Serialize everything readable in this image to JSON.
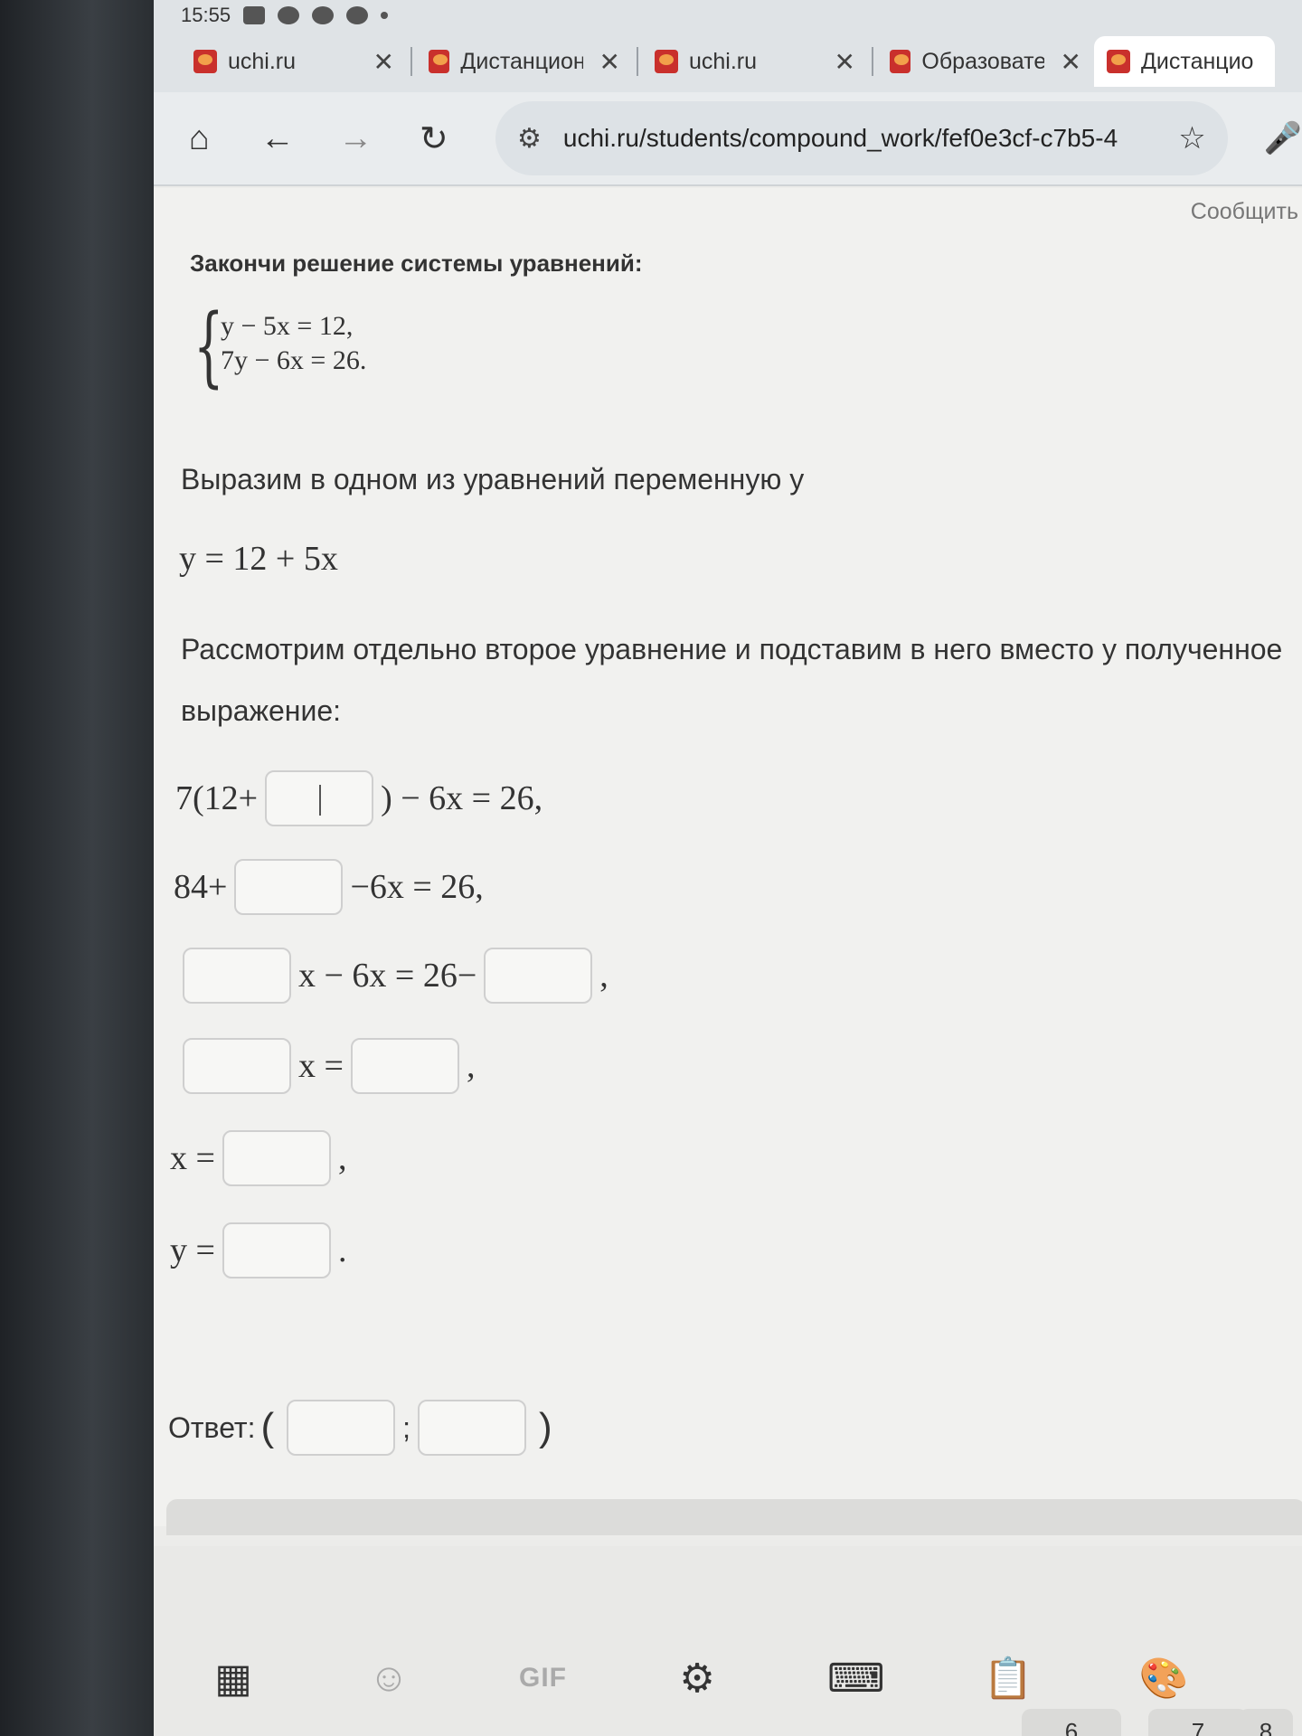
{
  "status": {
    "time": "15:55"
  },
  "tabs": [
    {
      "title": "uchi.ru"
    },
    {
      "title": "Дистанцион"
    },
    {
      "title": "uchi.ru"
    },
    {
      "title": "Образовате"
    },
    {
      "title": "Дистанцио"
    }
  ],
  "toolbar": {
    "url": "uchi.ru/students/compound_work/fef0e3cf-c7b5-4"
  },
  "page": {
    "report": "Сообщить",
    "task_title": "Закончи решение системы уравнений:",
    "system": [
      "y − 5x = 12,",
      "7y − 6x = 26."
    ],
    "express_text": "Выразим в одном из уравнений переменную y",
    "express_eq": "y = 12 + 5x",
    "substitute_text_1": "Рассмотрим отдельно второе уравнение и подставим в него вместо y полученное",
    "substitute_text_2": "выражение:",
    "line1_prefix": "7(12+",
    "line1_suffix": ") − 6x = 26,",
    "line2_prefix": "84+",
    "line2_suffix": "−6x = 26,",
    "line3_mid": "x − 6x = 26−",
    "line3_end": ",",
    "line4_mid": "x =",
    "line4_end": ",",
    "line5_prefix": "x =",
    "line5_end": ",",
    "line6_prefix": "y =",
    "line6_end": ".",
    "answer_label": "Ответ:",
    "answer_open": "(",
    "answer_sep": ";",
    "answer_close": ")"
  },
  "keyboard": {
    "gif_label": "GIF",
    "num_keys": [
      "6",
      "7",
      "8"
    ]
  }
}
